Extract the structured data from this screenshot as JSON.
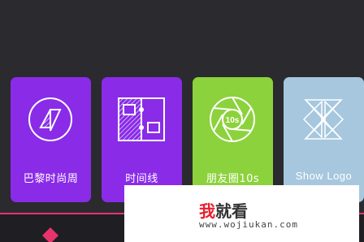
{
  "cards": [
    {
      "label": "巴黎时尚周",
      "icon": "fashion-week-icon",
      "color": "#8a2be8"
    },
    {
      "label": "时间线",
      "icon": "timeline-icon",
      "color": "#8a2be8"
    },
    {
      "label": "朋友圈10s",
      "icon": "aperture-10s-icon",
      "color": "#8cd23c",
      "icon_text": "10s"
    },
    {
      "label": "Show Logo",
      "icon": "show-logo-icon",
      "color": "#a6c7de"
    }
  ],
  "bottom_tabs": [
    {
      "icon": "diamond-icon",
      "color": "#e8336d"
    },
    {
      "icon": "frame-icon",
      "color": "#ffffff"
    },
    {
      "icon": "pen-icon",
      "color": "#ffffff"
    },
    {
      "icon": "palette-icon",
      "color": "#e8336d"
    }
  ],
  "watermark": {
    "title_first": "我",
    "title_rest": "就看",
    "url": "www.wojiukan.com"
  },
  "colors": {
    "background": "#2b2a2f",
    "accent": "#e8336d"
  }
}
